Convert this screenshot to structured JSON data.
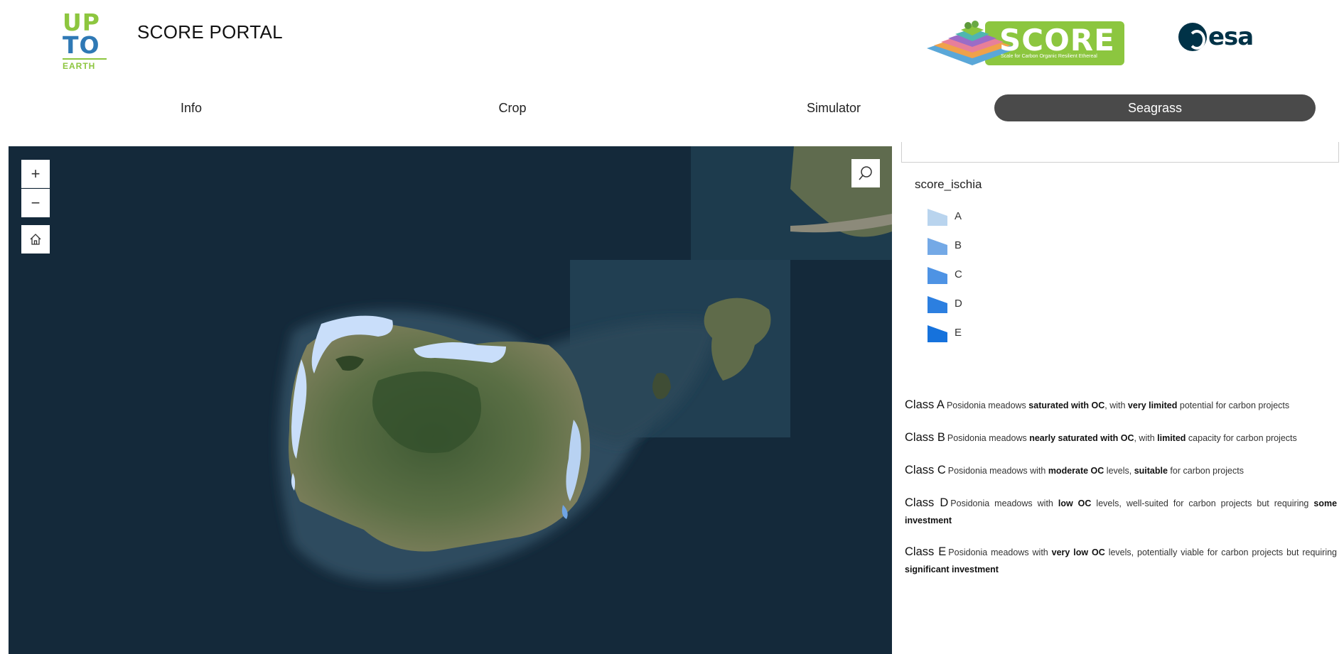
{
  "header": {
    "upto_logo": {
      "line1": "UP",
      "line2": "TO",
      "line3": "EARTH"
    },
    "title": "SCORE PORTAL",
    "score_logo": {
      "word": "SCORE",
      "tagline": "Scale for Carbon Organic Resilient Ethereal"
    },
    "esa_logo": {
      "text": "esa"
    }
  },
  "nav": {
    "tabs": [
      {
        "label": "Info",
        "active": false
      },
      {
        "label": "Crop",
        "active": false
      },
      {
        "label": "Simulator",
        "active": false
      },
      {
        "label": "Seagrass",
        "active": true
      }
    ]
  },
  "map": {
    "controls": {
      "zoom_in": "+",
      "zoom_out": "−",
      "home_icon": "home-icon",
      "search_icon": "search-icon"
    }
  },
  "legend": {
    "layer_name": "score_ischia",
    "items": [
      {
        "label": "A",
        "color": "#b9d4ee"
      },
      {
        "label": "B",
        "color": "#74a9e6"
      },
      {
        "label": "C",
        "color": "#4e93e4"
      },
      {
        "label": "D",
        "color": "#2c7fe0"
      },
      {
        "label": "E",
        "color": "#1672dc"
      }
    ]
  },
  "classes": [
    {
      "name": "Class A",
      "t1": "Posidonia meadows ",
      "b1": "saturated with OC",
      "t2": ", with ",
      "b2": "very limited",
      "t3": " potential for carbon projects"
    },
    {
      "name": "Class B",
      "t1": "Posidonia meadows ",
      "b1": "nearly saturated with OC",
      "t2": ", with ",
      "b2": "limited",
      "t3": " capacity for carbon projects"
    },
    {
      "name": "Class C",
      "t1": "Posidonia meadows with ",
      "b1": "moderate OC",
      "t2": " levels, ",
      "b2": "suitable",
      "t3": " for carbon projects"
    },
    {
      "name": "Class D",
      "t1": "Posidonia meadows with ",
      "b1": "low OC",
      "t2": " levels, well-suited for carbon projects but requiring ",
      "b2": "some investment",
      "t3": ""
    },
    {
      "name": "Class E",
      "t1": "Posidonia meadows with ",
      "b1": "very low OC",
      "t2": " levels, potentially viable for carbon projects but requiring ",
      "b2": "significant investment",
      "t3": ""
    }
  ]
}
